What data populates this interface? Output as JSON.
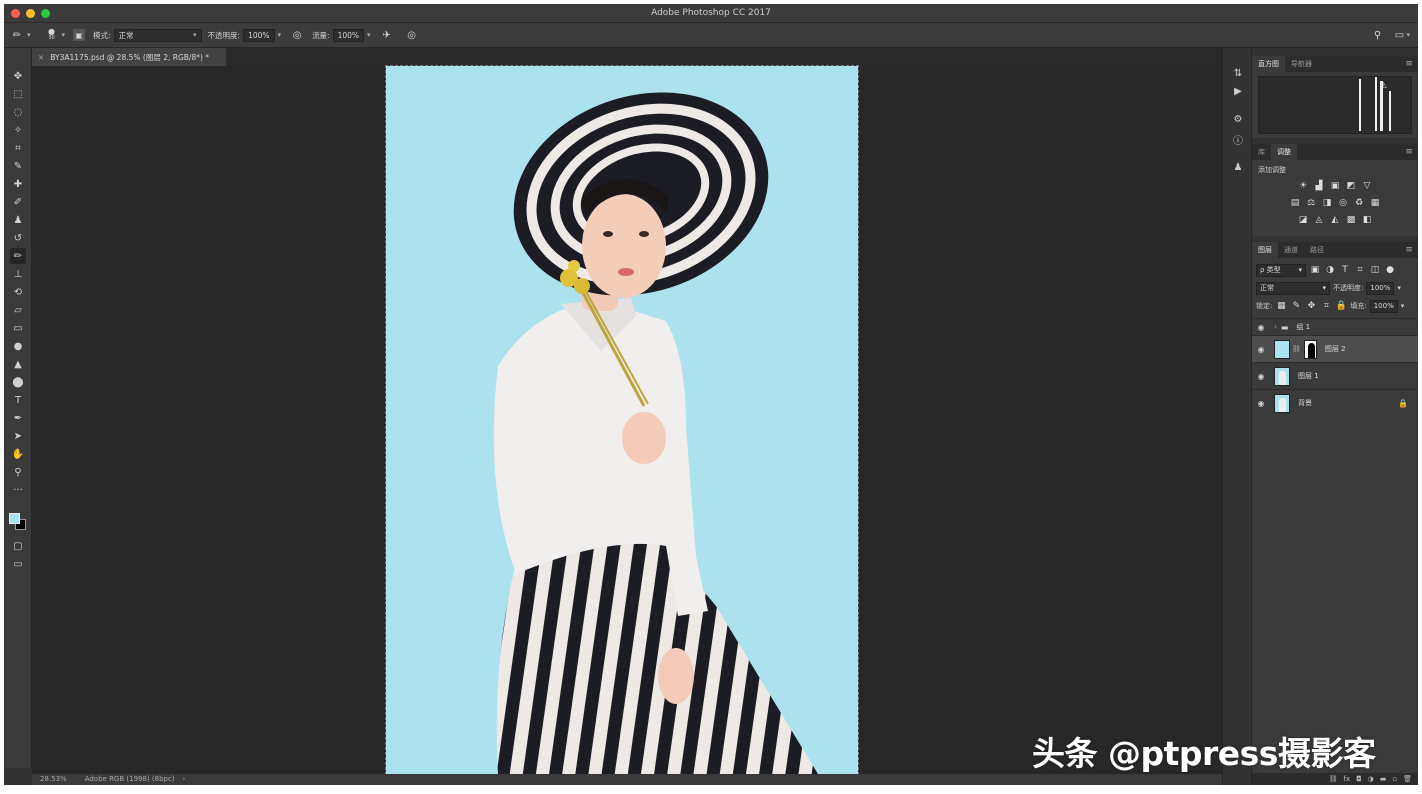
{
  "app": {
    "title": "Adobe Photoshop CC 2017"
  },
  "options_bar": {
    "brush_size": "30",
    "mode_label": "模式:",
    "mode_value": "正常",
    "opacity_label": "不透明度:",
    "opacity_value": "100%",
    "flow_label": "流量:",
    "flow_value": "100%"
  },
  "document": {
    "tab_title": "BY3A1175.psd @ 28.5% (图层 2, RGB/8*) *",
    "zoom": "28.53%",
    "profile": "Adobe RGB (1998) (8bpc)",
    "background_color": "#abe2ee"
  },
  "tools": [
    {
      "icon": "move-icon",
      "glyph": "✥"
    },
    {
      "icon": "marquee-icon",
      "glyph": "⬚"
    },
    {
      "icon": "lasso-icon",
      "glyph": "◌"
    },
    {
      "icon": "magic-wand-icon",
      "glyph": "✧"
    },
    {
      "icon": "crop-icon",
      "glyph": "⌗"
    },
    {
      "icon": "eyedropper-icon",
      "glyph": "✎"
    },
    {
      "icon": "healing-brush-icon",
      "glyph": "✚"
    },
    {
      "icon": "brush-icon",
      "glyph": "✐"
    },
    {
      "icon": "clone-stamp-icon",
      "glyph": "♟"
    },
    {
      "icon": "history-brush-icon",
      "glyph": "↺"
    },
    {
      "icon": "brush-active-icon",
      "glyph": "✏"
    },
    {
      "icon": "stamp-icon",
      "glyph": "⊥"
    },
    {
      "icon": "history-icon",
      "glyph": "⟲"
    },
    {
      "icon": "eraser-icon",
      "glyph": "▱"
    },
    {
      "icon": "gradient-icon",
      "glyph": "▭"
    },
    {
      "icon": "blur-icon",
      "glyph": "●"
    },
    {
      "icon": "dodge-icon",
      "glyph": "▲"
    },
    {
      "icon": "sponge-icon",
      "glyph": "⬤"
    },
    {
      "icon": "type-icon",
      "glyph": "T"
    },
    {
      "icon": "pen-icon",
      "glyph": "✒"
    },
    {
      "icon": "path-select-icon",
      "glyph": "➤"
    },
    {
      "icon": "hand-icon",
      "glyph": "✋"
    },
    {
      "icon": "zoom-icon",
      "glyph": "⚲"
    },
    {
      "icon": "more-icon",
      "glyph": "···"
    }
  ],
  "panels": {
    "top_tabs": [
      "直方图",
      "导航器"
    ],
    "mid_tabs": [
      "库",
      "调整"
    ],
    "adj_label": "添加调整",
    "adjust_icons": [
      [
        "☀",
        "▟",
        "▣",
        "◩",
        "▽"
      ],
      [
        "▤",
        "⚖",
        "◨",
        "◎",
        "♻",
        "▦"
      ],
      [
        "◪",
        "◬",
        "◭",
        "▩",
        "◧"
      ]
    ],
    "layer_tabs": [
      "图层",
      "通道",
      "路径"
    ],
    "filter_kind": "ρ 类型",
    "blend_mode": "正常",
    "opacity_label": "不透明度:",
    "opacity_value": "100%",
    "lock_label": "锁定:",
    "fill_label": "填充:",
    "fill_value": "100%",
    "layers": [
      {
        "name": "组 1",
        "type": "group"
      },
      {
        "name": "图层 2",
        "type": "masked",
        "selected": true
      },
      {
        "name": "图层 1",
        "type": "image"
      },
      {
        "name": "背景",
        "type": "background",
        "locked": true
      }
    ],
    "footer_icons": [
      "⛓",
      "fx",
      "◘",
      "◑",
      "▬",
      "▫",
      "🗑"
    ]
  },
  "watermark": "头条 @ptpress摄影客"
}
